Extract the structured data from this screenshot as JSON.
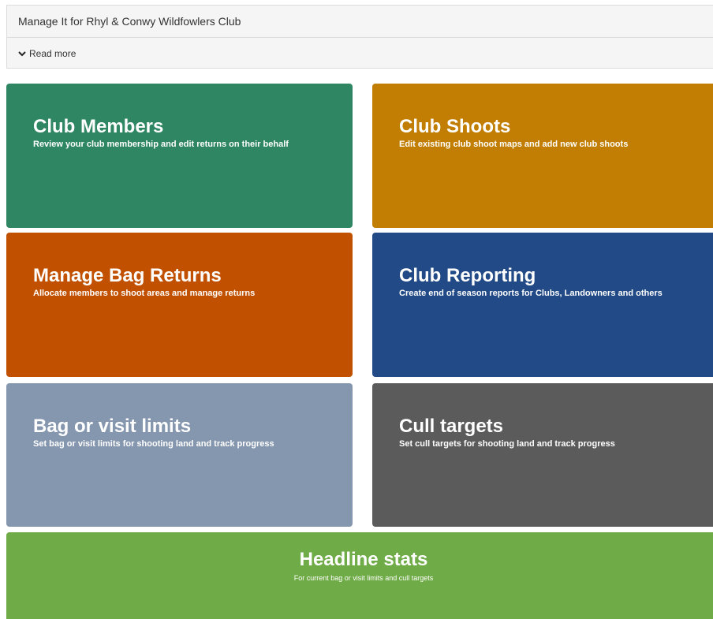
{
  "header": {
    "title": "Manage It for Rhyl & Conwy Wildfowlers Club",
    "read_more": "Read more",
    "read_more_icon": "chevron-down-icon"
  },
  "tiles": [
    {
      "title": "Club Members",
      "desc": "Review your club membership and edit returns on their behalf",
      "color": "#2e8663"
    },
    {
      "title": "Club Shoots",
      "desc": "Edit existing club shoot maps and add new club shoots",
      "color": "#c27e02"
    },
    {
      "title": "Manage Bag Returns",
      "desc": "Allocate members to shoot areas and manage returns",
      "color": "#c15000"
    },
    {
      "title": "Club Reporting",
      "desc": "Create end of season reports for Clubs, Landowners and others",
      "color": "#214a86"
    },
    {
      "title": "Bag or visit limits",
      "desc": "Set bag or visit limits for shooting land and track progress",
      "color": "#8596af"
    },
    {
      "title": "Cull targets",
      "desc": "Set cull targets for shooting land and track progress",
      "color": "#5b5b5b"
    },
    {
      "title": "Headline stats",
      "desc": "For current bag or visit limits and cull targets",
      "color": "#6fab46"
    }
  ]
}
